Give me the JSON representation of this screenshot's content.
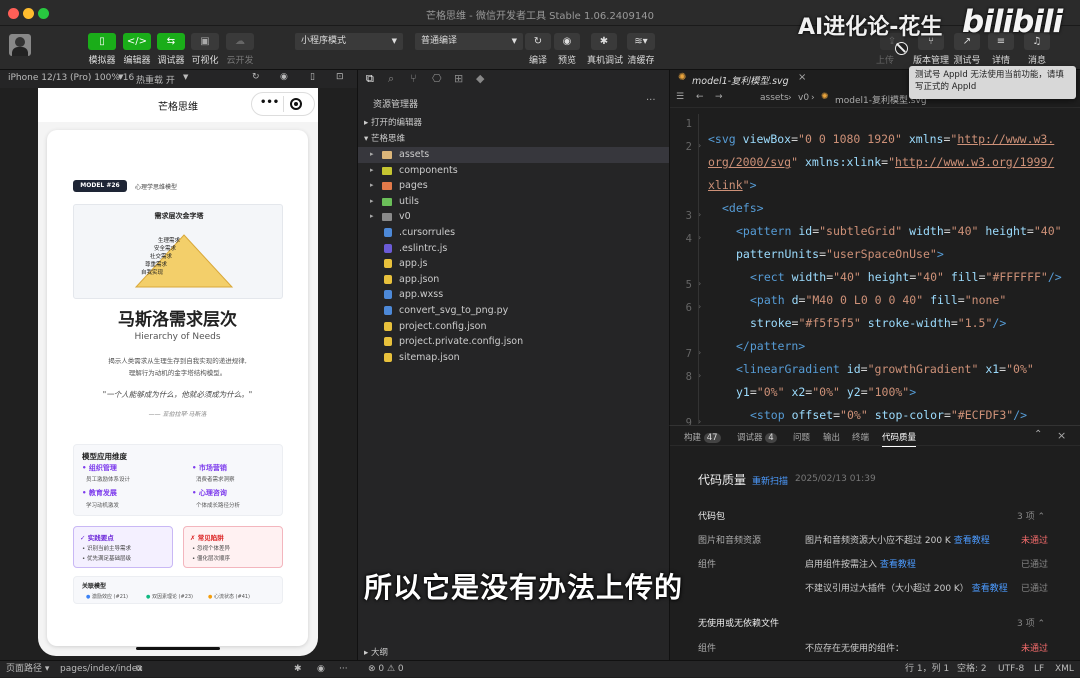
{
  "window": {
    "title": "芒格思维 - 微信开发者工具 Stable 1.06.2409140"
  },
  "watermark": {
    "text": "AI进化论-花生",
    "logo": "bilibili"
  },
  "toolbar": {
    "left": [
      {
        "label": "模拟器",
        "icon": "phone-icon"
      },
      {
        "label": "编辑器",
        "icon": "code-icon"
      },
      {
        "label": "调试器",
        "icon": "debug-icon"
      },
      {
        "label": "可视化",
        "icon": "layout-icon"
      },
      {
        "label": "云开发",
        "icon": "cloud-icon"
      }
    ],
    "mode_select": "小程序模式",
    "compile_select": "普通编译",
    "mid": [
      {
        "label": "编译"
      },
      {
        "label": "预览"
      },
      {
        "label": "真机调试"
      },
      {
        "label": "清缓存"
      }
    ],
    "right": [
      {
        "label": "上传"
      },
      {
        "label": "版本管理"
      },
      {
        "label": "测试号"
      },
      {
        "label": "详情"
      },
      {
        "label": "消息"
      }
    ],
    "tooltip": "测试号 AppId 无法使用当前功能，请填写正式的 AppId"
  },
  "simulator": {
    "device": "iPhone 12/13 (Pro) 100% 16",
    "hotreload": "热重载 开",
    "nav_title": "芒格思维",
    "badge": "MODEL #26",
    "badge_sub": "心理学思维模型",
    "pyramid_title": "需求层次金字塔",
    "pyramid_levels": [
      "生理需求",
      "安全需求",
      "社交需求",
      "尊重需求",
      "自我实现"
    ],
    "main_title": "马斯洛需求层次",
    "subtitle": "Hierarchy of Needs",
    "desc1": "揭示人类需求从生理生存到自我实现的递进规律,",
    "desc2": "理解行为动机的金字塔结构模型。",
    "quote": "\"一个人能够成为什么，他就必须成为什么。\"",
    "quote_author": "—— 亚伯拉罕·马斯洛",
    "apps_title": "模型应用维度",
    "apps": [
      {
        "name": "组织管理",
        "desc": "员工激励体系设计"
      },
      {
        "name": "市场营销",
        "desc": "消费者需求洞察"
      },
      {
        "name": "教育发展",
        "desc": "学习动机激发"
      },
      {
        "name": "心理咨询",
        "desc": "个体成长路径分析"
      }
    ],
    "practice_title": "✓ 实践要点",
    "practice": [
      "识别当前主导需求",
      "优先满足基础层级"
    ],
    "pitfall_title": "✗ 常见陷阱",
    "pitfalls": [
      "忽视个体差异",
      "僵化层次顺序"
    ],
    "related_title": "关联模型",
    "related": [
      "激励效应 (#21)",
      "双因素理论 (#23)",
      "心流状态 (#41)"
    ]
  },
  "explorer": {
    "header": "资源管理器",
    "open_editors": "打开的编辑器",
    "project": "芒格思维",
    "items": [
      {
        "name": "assets",
        "type": "folder",
        "icon": "folder-icon",
        "color": "#dcb67a"
      },
      {
        "name": "components",
        "type": "folder",
        "icon": "folder-icon",
        "color": "#c5c531"
      },
      {
        "name": "pages",
        "type": "folder",
        "icon": "folder-icon",
        "color": "#e27a4a"
      },
      {
        "name": "utils",
        "type": "folder",
        "icon": "folder-icon",
        "color": "#6bbf59"
      },
      {
        "name": "v0",
        "type": "folder",
        "icon": "folder-icon",
        "color": "#8a8a8a"
      },
      {
        "name": ".cursorrules",
        "type": "file",
        "icon": "file-icon",
        "color": "#4d89d8"
      },
      {
        "name": ".eslintrc.js",
        "type": "file",
        "icon": "eslint-icon",
        "color": "#6b5bd6"
      },
      {
        "name": "app.js",
        "type": "file",
        "icon": "js-icon",
        "color": "#e8c13c"
      },
      {
        "name": "app.json",
        "type": "file",
        "icon": "json-icon",
        "color": "#e8c13c"
      },
      {
        "name": "app.wxss",
        "type": "file",
        "icon": "css-icon",
        "color": "#4d89d8"
      },
      {
        "name": "convert_svg_to_png.py",
        "type": "file",
        "icon": "python-icon",
        "color": "#4d89d8"
      },
      {
        "name": "project.config.json",
        "type": "file",
        "icon": "json-icon",
        "color": "#e8c13c"
      },
      {
        "name": "project.private.config.json",
        "type": "file",
        "icon": "json-icon",
        "color": "#e8c13c"
      },
      {
        "name": "sitemap.json",
        "type": "file",
        "icon": "json-icon",
        "color": "#e8c13c"
      }
    ],
    "outline": "大纲"
  },
  "editor": {
    "tab": "model1-复利模型.svg",
    "breadcrumb": [
      "assets",
      "v0",
      "model1-复利模型.svg"
    ],
    "line_numbers": [
      "1",
      "2",
      "",
      "",
      "3",
      "4",
      "",
      "5",
      "6",
      "",
      "7",
      "8",
      "",
      "9"
    ]
  },
  "panel": {
    "tabs": [
      {
        "label": "构建",
        "count": "47"
      },
      {
        "label": "调试器",
        "count": "4"
      },
      {
        "label": "问题"
      },
      {
        "label": "输出"
      },
      {
        "label": "终端"
      },
      {
        "label": "代码质量"
      }
    ],
    "title": "代码质量",
    "rescan": "重新扫描",
    "date": "2025/02/13 01:39",
    "group1": "代码包",
    "group1_count": "3 项",
    "rows": [
      {
        "name": "图片和音频资源",
        "msg": "图片和音频资源大小应不超过 200 K",
        "link": "查看教程",
        "status": "未通过",
        "fail": true
      },
      {
        "name": "组件",
        "msg": "启用组件按需注入",
        "link": "查看教程",
        "status": "已通过",
        "fail": false
      },
      {
        "name": "",
        "msg": "不建议引用过大插件（大小超过 200 K）",
        "link": "查看教程",
        "status": "已通过",
        "fail": false
      }
    ],
    "group2": "无使用或无依赖文件",
    "group2_count": "3 项",
    "row2": {
      "name": "组件",
      "msg": "不应存在无使用的组件：",
      "status": "未通过"
    }
  },
  "subtitle_overlay": "所以它是没有办法上传的",
  "statusbar": {
    "path_label": "页面路径",
    "path": "pages/index/index",
    "problems": "⊗ 0 ⚠ 0",
    "position": "行 1，列 1",
    "spaces": "空格: 2",
    "encoding": "UTF-8",
    "eol": "LF",
    "lang": "XML"
  }
}
